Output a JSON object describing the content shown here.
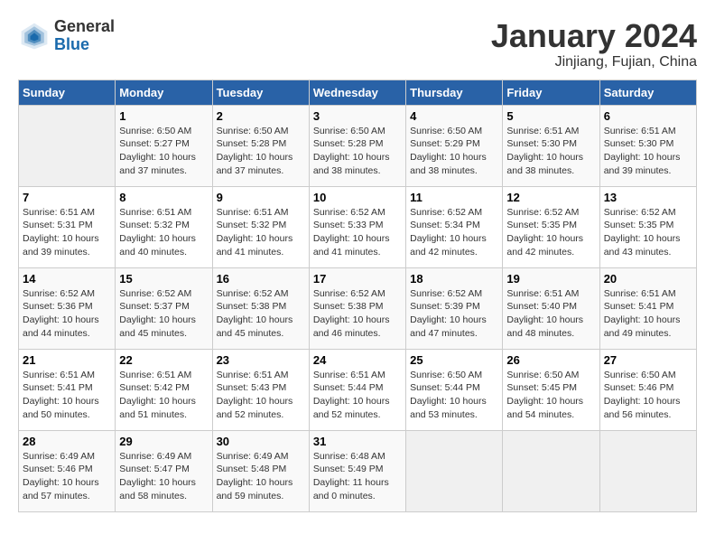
{
  "header": {
    "logo_general": "General",
    "logo_blue": "Blue",
    "month_title": "January 2024",
    "subtitle": "Jinjiang, Fujian, China"
  },
  "days_of_week": [
    "Sunday",
    "Monday",
    "Tuesday",
    "Wednesday",
    "Thursday",
    "Friday",
    "Saturday"
  ],
  "weeks": [
    [
      {
        "day": "",
        "info": ""
      },
      {
        "day": "1",
        "info": "Sunrise: 6:50 AM\nSunset: 5:27 PM\nDaylight: 10 hours\nand 37 minutes."
      },
      {
        "day": "2",
        "info": "Sunrise: 6:50 AM\nSunset: 5:28 PM\nDaylight: 10 hours\nand 37 minutes."
      },
      {
        "day": "3",
        "info": "Sunrise: 6:50 AM\nSunset: 5:28 PM\nDaylight: 10 hours\nand 38 minutes."
      },
      {
        "day": "4",
        "info": "Sunrise: 6:50 AM\nSunset: 5:29 PM\nDaylight: 10 hours\nand 38 minutes."
      },
      {
        "day": "5",
        "info": "Sunrise: 6:51 AM\nSunset: 5:30 PM\nDaylight: 10 hours\nand 38 minutes."
      },
      {
        "day": "6",
        "info": "Sunrise: 6:51 AM\nSunset: 5:30 PM\nDaylight: 10 hours\nand 39 minutes."
      }
    ],
    [
      {
        "day": "7",
        "info": "Sunrise: 6:51 AM\nSunset: 5:31 PM\nDaylight: 10 hours\nand 39 minutes."
      },
      {
        "day": "8",
        "info": "Sunrise: 6:51 AM\nSunset: 5:32 PM\nDaylight: 10 hours\nand 40 minutes."
      },
      {
        "day": "9",
        "info": "Sunrise: 6:51 AM\nSunset: 5:32 PM\nDaylight: 10 hours\nand 41 minutes."
      },
      {
        "day": "10",
        "info": "Sunrise: 6:52 AM\nSunset: 5:33 PM\nDaylight: 10 hours\nand 41 minutes."
      },
      {
        "day": "11",
        "info": "Sunrise: 6:52 AM\nSunset: 5:34 PM\nDaylight: 10 hours\nand 42 minutes."
      },
      {
        "day": "12",
        "info": "Sunrise: 6:52 AM\nSunset: 5:35 PM\nDaylight: 10 hours\nand 42 minutes."
      },
      {
        "day": "13",
        "info": "Sunrise: 6:52 AM\nSunset: 5:35 PM\nDaylight: 10 hours\nand 43 minutes."
      }
    ],
    [
      {
        "day": "14",
        "info": "Sunrise: 6:52 AM\nSunset: 5:36 PM\nDaylight: 10 hours\nand 44 minutes."
      },
      {
        "day": "15",
        "info": "Sunrise: 6:52 AM\nSunset: 5:37 PM\nDaylight: 10 hours\nand 45 minutes."
      },
      {
        "day": "16",
        "info": "Sunrise: 6:52 AM\nSunset: 5:38 PM\nDaylight: 10 hours\nand 45 minutes."
      },
      {
        "day": "17",
        "info": "Sunrise: 6:52 AM\nSunset: 5:38 PM\nDaylight: 10 hours\nand 46 minutes."
      },
      {
        "day": "18",
        "info": "Sunrise: 6:52 AM\nSunset: 5:39 PM\nDaylight: 10 hours\nand 47 minutes."
      },
      {
        "day": "19",
        "info": "Sunrise: 6:51 AM\nSunset: 5:40 PM\nDaylight: 10 hours\nand 48 minutes."
      },
      {
        "day": "20",
        "info": "Sunrise: 6:51 AM\nSunset: 5:41 PM\nDaylight: 10 hours\nand 49 minutes."
      }
    ],
    [
      {
        "day": "21",
        "info": "Sunrise: 6:51 AM\nSunset: 5:41 PM\nDaylight: 10 hours\nand 50 minutes."
      },
      {
        "day": "22",
        "info": "Sunrise: 6:51 AM\nSunset: 5:42 PM\nDaylight: 10 hours\nand 51 minutes."
      },
      {
        "day": "23",
        "info": "Sunrise: 6:51 AM\nSunset: 5:43 PM\nDaylight: 10 hours\nand 52 minutes."
      },
      {
        "day": "24",
        "info": "Sunrise: 6:51 AM\nSunset: 5:44 PM\nDaylight: 10 hours\nand 52 minutes."
      },
      {
        "day": "25",
        "info": "Sunrise: 6:50 AM\nSunset: 5:44 PM\nDaylight: 10 hours\nand 53 minutes."
      },
      {
        "day": "26",
        "info": "Sunrise: 6:50 AM\nSunset: 5:45 PM\nDaylight: 10 hours\nand 54 minutes."
      },
      {
        "day": "27",
        "info": "Sunrise: 6:50 AM\nSunset: 5:46 PM\nDaylight: 10 hours\nand 56 minutes."
      }
    ],
    [
      {
        "day": "28",
        "info": "Sunrise: 6:49 AM\nSunset: 5:46 PM\nDaylight: 10 hours\nand 57 minutes."
      },
      {
        "day": "29",
        "info": "Sunrise: 6:49 AM\nSunset: 5:47 PM\nDaylight: 10 hours\nand 58 minutes."
      },
      {
        "day": "30",
        "info": "Sunrise: 6:49 AM\nSunset: 5:48 PM\nDaylight: 10 hours\nand 59 minutes."
      },
      {
        "day": "31",
        "info": "Sunrise: 6:48 AM\nSunset: 5:49 PM\nDaylight: 11 hours\nand 0 minutes."
      },
      {
        "day": "",
        "info": ""
      },
      {
        "day": "",
        "info": ""
      },
      {
        "day": "",
        "info": ""
      }
    ]
  ]
}
